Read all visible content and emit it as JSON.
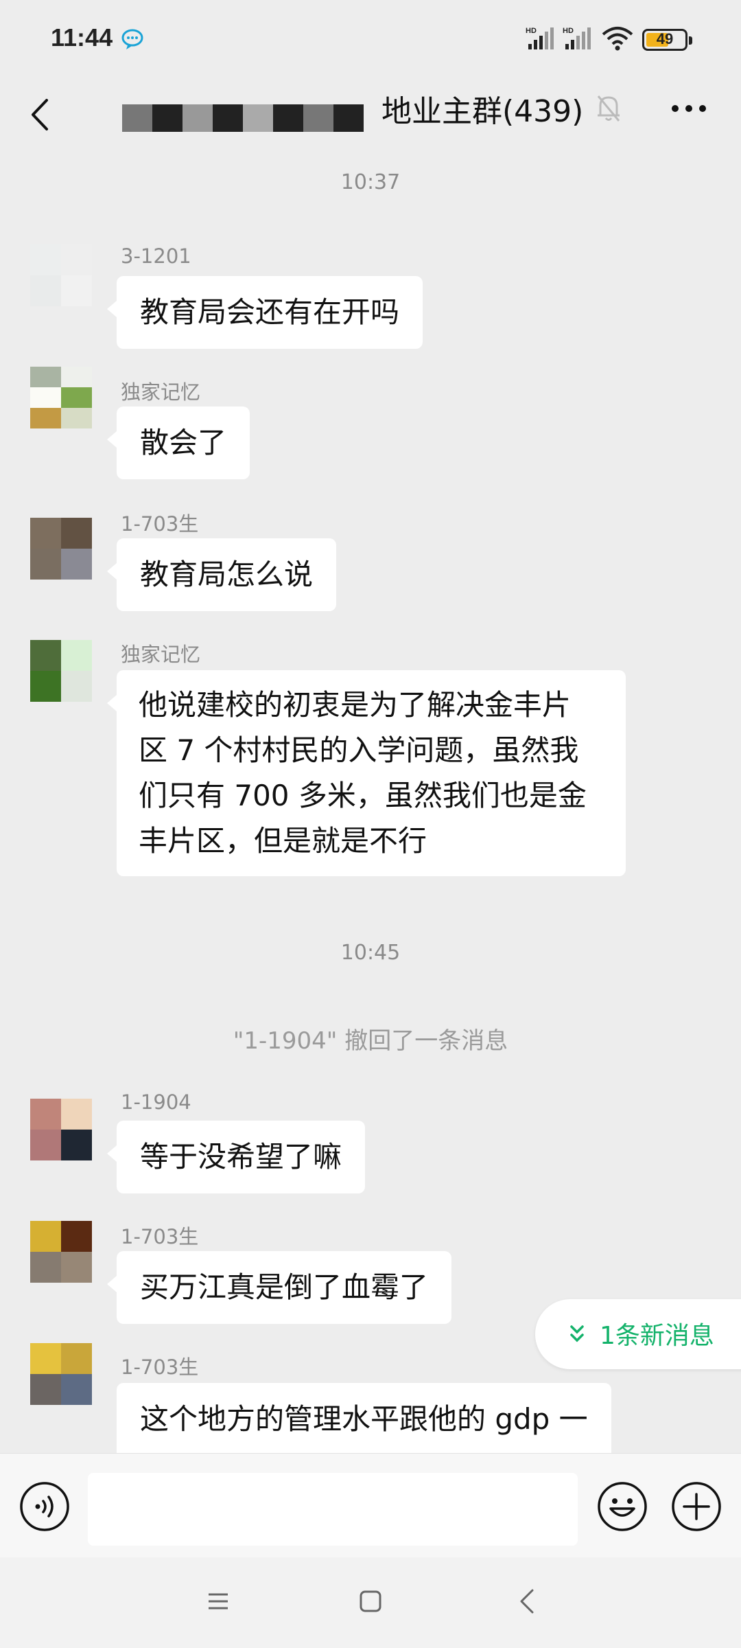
{
  "status_bar": {
    "time": "11:44",
    "battery": "49",
    "signal_label": "HD"
  },
  "header": {
    "title": "地业主群(439)"
  },
  "timestamps": [
    "10:37",
    "10:45"
  ],
  "messages": [
    {
      "sender": "3-1201",
      "text": "教育局会还有在开吗"
    },
    {
      "sender": "独家记忆",
      "text": "散会了"
    },
    {
      "sender": "1-703生",
      "text": "教育局怎么说"
    },
    {
      "sender": "独家记忆",
      "lines": [
        "他说建校的初衷是为了解决金丰片",
        "区 7 个村村民的入学问题，虽然我",
        "们只有 700 多米，虽然我们也是金",
        "丰片区，但是就是不行"
      ]
    },
    {
      "sender": "1-1904",
      "text": "等于没希望了嘛"
    },
    {
      "sender": "1-703生",
      "text": "买万江真是倒了血霉了"
    },
    {
      "sender": "1-703生",
      "text": "这个地方的管理水平跟他的 gdp 一"
    }
  ],
  "recall_notice": "\"1-1904\" 撤回了一条消息",
  "new_message_pill": "1条新消息",
  "colors": {
    "background": "#ededed",
    "bubble": "#ffffff",
    "accent_green": "#13b26a"
  }
}
